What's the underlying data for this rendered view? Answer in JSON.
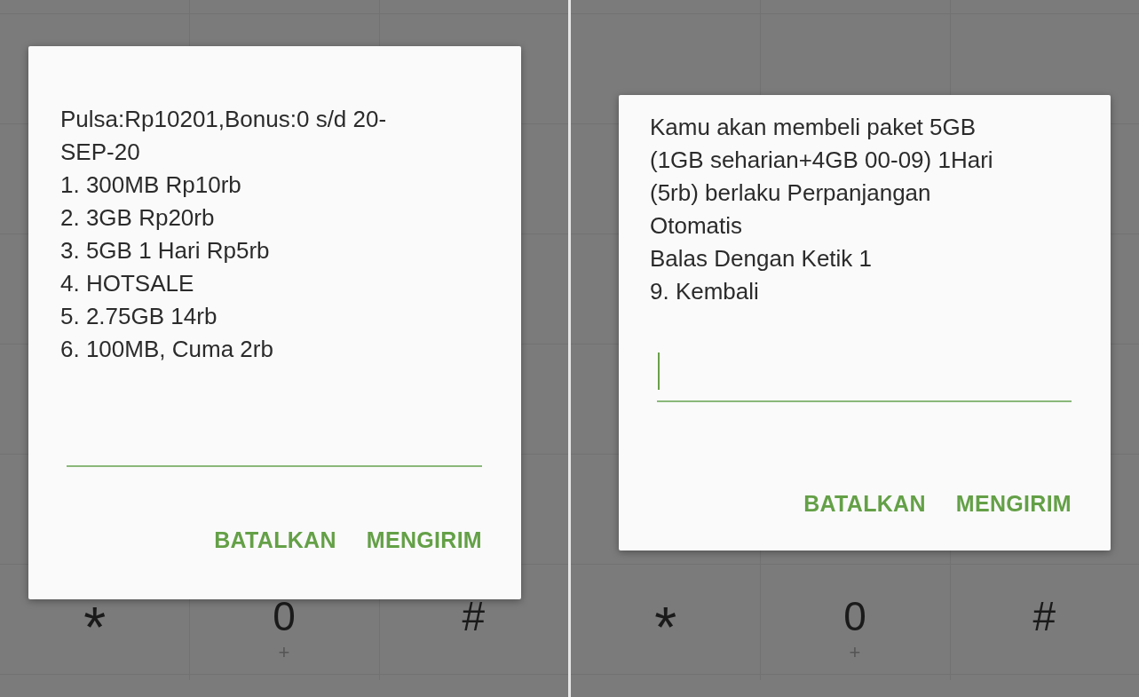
{
  "panels": [
    {
      "dialog": {
        "message_lines": [
          "Pulsa:Rp10201,Bonus:0 s/d 20-",
          "SEP-20",
          "1. 300MB Rp10rb",
          "2. 3GB Rp20rb",
          "3. 5GB 1 Hari Rp5rb",
          "4. HOTSALE",
          "5. 2.75GB 14rb",
          "6. 100MB, Cuma 2rb"
        ],
        "input": {
          "focused": false
        },
        "buttons": [
          "BATALKAN",
          "MENGIRIM"
        ]
      },
      "keypad": [
        {
          "label": "*"
        },
        {
          "label": "0",
          "sub": "+"
        },
        {
          "label": "#"
        }
      ]
    },
    {
      "dialog": {
        "message_lines": [
          "Kamu akan membeli paket 5GB",
          "(1GB seharian+4GB 00-09) 1Hari",
          "(5rb) berlaku Perpanjangan",
          "Otomatis",
          "Balas Dengan Ketik 1",
          "9. Kembali"
        ],
        "input": {
          "focused": true
        },
        "buttons": [
          "BATALKAN",
          "MENGIRIM"
        ]
      },
      "keypad": [
        {
          "label": "*"
        },
        {
          "label": "0",
          "sub": "+"
        },
        {
          "label": "#"
        }
      ]
    }
  ]
}
